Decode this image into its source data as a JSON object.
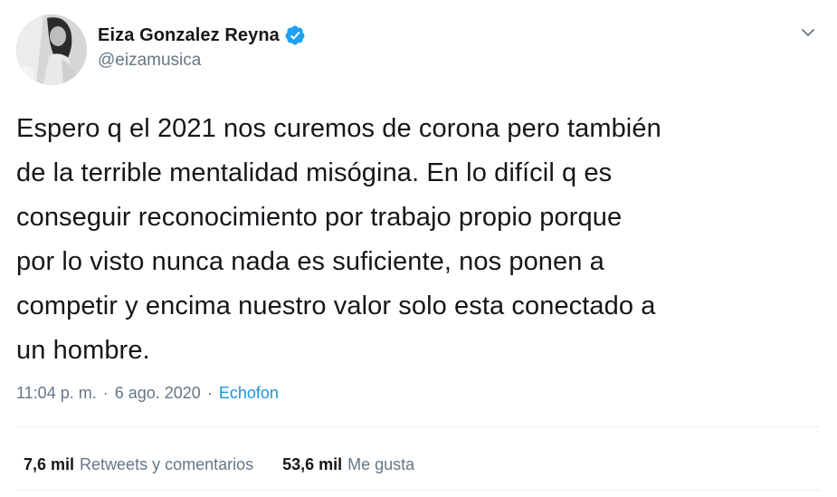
{
  "tweet": {
    "author": {
      "name": "Eiza Gonzalez Reyna",
      "handle": "@eizamusica",
      "verified": true
    },
    "text": "Espero q el 2021 nos curemos de corona pero también\nde la terrible mentalidad misógina. En lo difícil q es\nconseguir reconocimiento por trabajo propio porque\npor lo visto nunca nada es suficiente, nos ponen a\ncompetir y encima nuestro valor solo esta conectado a\nun hombre.",
    "time": "11:04 p. m.",
    "separator": "·",
    "date": "6 ago. 2020",
    "source": "Echofon",
    "stats": {
      "retweets_count": "7,6 mil",
      "retweets_label": "Retweets y comentarios",
      "likes_count": "53,6 mil",
      "likes_label": "Me gusta"
    }
  },
  "colors": {
    "text": "#14171a",
    "secondary": "#657786",
    "link": "#1b95e0",
    "verified": "#1da1f2",
    "divider": "#e6ecf0"
  },
  "icons": {
    "verified": "verified-badge-icon",
    "menu": "chevron-down-icon"
  }
}
